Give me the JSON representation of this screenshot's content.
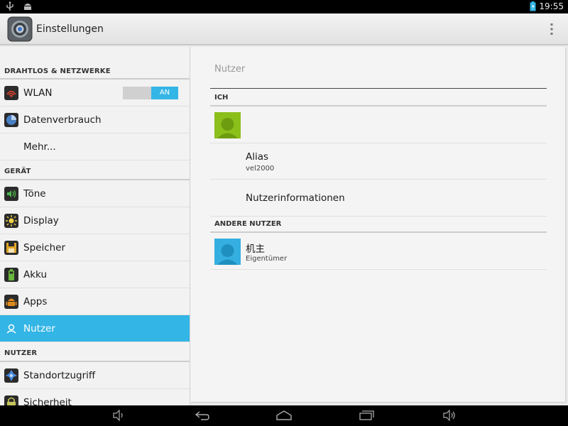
{
  "status_bar": {
    "time": "19:55"
  },
  "action_bar": {
    "title": "Einstellungen"
  },
  "sidebar": {
    "sections": [
      {
        "label": "DRAHTLOS & NETZWERKE"
      },
      {
        "label": "GERÄT"
      },
      {
        "label": "NUTZER"
      }
    ],
    "items": [
      {
        "label": "WLAN",
        "toggle": "AN"
      },
      {
        "label": "Datenverbrauch"
      },
      {
        "label": "Mehr..."
      },
      {
        "label": "Töne"
      },
      {
        "label": "Display"
      },
      {
        "label": "Speicher"
      },
      {
        "label": "Akku"
      },
      {
        "label": "Apps"
      },
      {
        "label": "Nutzer"
      },
      {
        "label": "Standortzugriff"
      },
      {
        "label": "Sicherheit"
      }
    ]
  },
  "main": {
    "title": "Nutzer",
    "me_section": "ICH",
    "alias_label": "Alias",
    "alias_value": "vel2000",
    "user_info": "Nutzerinformationen",
    "other_section": "ANDERE NUTZER",
    "other_user": {
      "name": "机主",
      "role": "Eigentümer"
    }
  },
  "colors": {
    "accent": "#33b5e5",
    "me_avatar": "#8bbf1a",
    "owner_avatar": "#35aee0"
  }
}
